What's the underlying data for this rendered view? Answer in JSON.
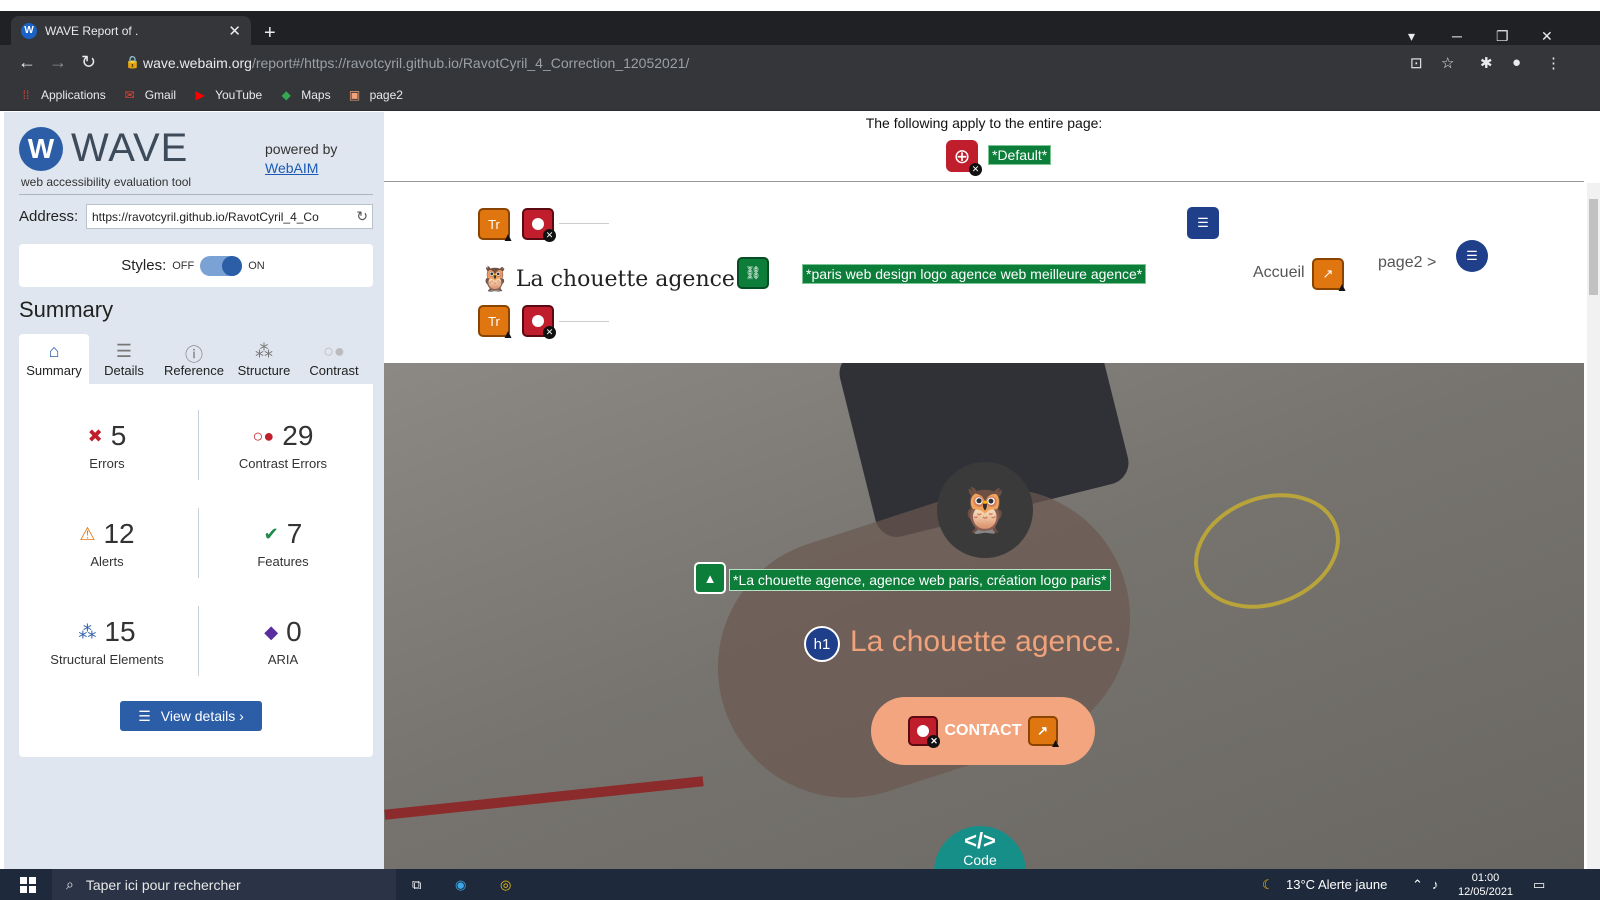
{
  "browser": {
    "tab_title": "WAVE Report of .",
    "tab_favicon": "W",
    "url_host": "wave.webaim.org",
    "url_path": "/report#/https://ravotcyril.github.io/RavotCyril_4_Correction_12052021/",
    "bookmarks": [
      {
        "label": "Applications",
        "icon": "apps-grid-icon"
      },
      {
        "label": "Gmail",
        "icon": "gmail-icon"
      },
      {
        "label": "YouTube",
        "icon": "youtube-icon"
      },
      {
        "label": "Maps",
        "icon": "maps-icon"
      },
      {
        "label": "page2",
        "icon": "page-icon"
      }
    ]
  },
  "wave": {
    "logo_text": "WAVE",
    "logo_sub": "web accessibility evaluation tool",
    "powered_by": "powered by",
    "webaim_link": "WebAIM",
    "address_label": "Address:",
    "address_value": "https://ravotcyril.github.io/RavotCyril_4_Co",
    "styles_label": "Styles:",
    "styles_off": "OFF",
    "styles_on": "ON",
    "summary_heading": "Summary",
    "tabs": [
      {
        "label": "Summary",
        "icon": "home-icon"
      },
      {
        "label": "Details",
        "icon": "list-icon"
      },
      {
        "label": "Reference",
        "icon": "info-icon"
      },
      {
        "label": "Structure",
        "icon": "hierarchy-icon"
      },
      {
        "label": "Contrast",
        "icon": "contrast-icon"
      }
    ],
    "stats": {
      "errors": {
        "value": "5",
        "label": "Errors"
      },
      "contrast": {
        "value": "29",
        "label": "Contrast Errors"
      },
      "alerts": {
        "value": "12",
        "label": "Alerts"
      },
      "features": {
        "value": "7",
        "label": "Features"
      },
      "structural": {
        "value": "15",
        "label": "Structural Elements"
      },
      "aria": {
        "value": "0",
        "label": "ARIA"
      }
    },
    "view_details": "View details ›"
  },
  "page": {
    "banner_caption": "The following apply to the entire page:",
    "default_label": "*Default*",
    "logo_alt": "*paris web design logo agence web meilleure agence*",
    "brand": "La chouette agence",
    "nav_accueil": "Accueil",
    "nav_page2": "page2 >",
    "hero_alt": "*La chouette agence, agence web paris, création logo paris*",
    "h1_badge": "h1",
    "hero_title": "La chouette agence.",
    "contact": "CONTACT",
    "code_label": "Code",
    "code_symbol": "</>"
  },
  "taskbar": {
    "search_placeholder": "Taper ici pour rechercher",
    "weather": "13°C  Alerte jaune",
    "time": "01:00",
    "date": "12/05/2021"
  }
}
